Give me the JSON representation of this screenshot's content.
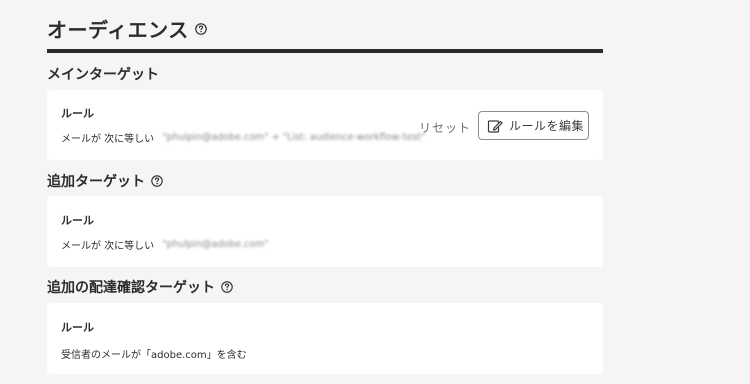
{
  "page": {
    "title": "オーディエンス"
  },
  "main_target": {
    "heading": "メインターゲット",
    "rule_label": "ルール",
    "rule_prefix": "メールが 次に等しい",
    "rule_value_blurred": "\"phulpin@adobe.com\" + \"List: audience-workflow-test\"",
    "reset_label": "リセット",
    "edit_label": "ルールを編集"
  },
  "additional_target": {
    "heading": "追加ターゲット",
    "rule_label": "ルール",
    "rule_prefix": "メールが 次に等しい",
    "rule_value_blurred": "\"phulpin@adobe.com\""
  },
  "proof_target": {
    "heading": "追加の配達確認ターゲット",
    "rule_label": "ルール",
    "rule_text": "受信者のメールが「adobe.com」を含む"
  },
  "colors": {
    "background": "#f5f5f5",
    "card": "#ffffff",
    "text": "#2c2c2c",
    "muted": "#6e6e6e"
  }
}
